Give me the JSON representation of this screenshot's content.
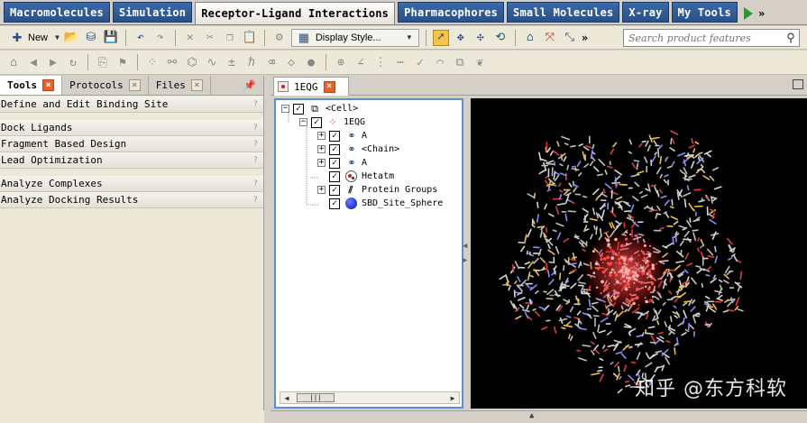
{
  "top_tabs": [
    {
      "label": "Macromolecules",
      "active": false
    },
    {
      "label": "Simulation",
      "active": false
    },
    {
      "label": "Receptor-Ligand Interactions",
      "active": true
    },
    {
      "label": "Pharmacophores",
      "active": false
    },
    {
      "label": "Small Molecules",
      "active": false
    },
    {
      "label": "X-ray",
      "active": false
    },
    {
      "label": "My Tools",
      "active": false
    }
  ],
  "toolbar": {
    "new_label": "New",
    "display_style_label": "Display Style...",
    "search_placeholder": "Search product features"
  },
  "left_panel": {
    "tabs": [
      {
        "label": "Tools",
        "active": true
      },
      {
        "label": "Protocols",
        "active": false
      },
      {
        "label": "Files",
        "active": false
      }
    ],
    "tools": [
      {
        "label": "Define and Edit Binding Site",
        "help": "?"
      },
      {
        "label": "Dock Ligands",
        "help": "?"
      },
      {
        "label": "Fragment Based Design",
        "help": "?"
      },
      {
        "label": "Lead Optimization",
        "help": "?"
      },
      {
        "label": "Analyze Complexes",
        "help": "?"
      },
      {
        "label": "Analyze Docking Results",
        "help": "?"
      }
    ]
  },
  "document": {
    "tab_label": "1EQG"
  },
  "tree": {
    "root": "<Cell>",
    "molecule": "1EQG",
    "items": [
      {
        "label": "A",
        "icon": "chain-icon",
        "expandable": true
      },
      {
        "label": "<Chain>",
        "icon": "chain-icon",
        "expandable": true
      },
      {
        "label": "A",
        "icon": "chain-icon",
        "expandable": true
      },
      {
        "label": "Hetatm",
        "icon": "hetatm-icon",
        "expandable": false
      },
      {
        "label": "Protein Groups",
        "icon": "groups-icon",
        "expandable": true
      },
      {
        "label": "SBD_Site_Sphere",
        "icon": "sphere-icon",
        "expandable": false
      }
    ]
  },
  "viewer": {
    "watermark": "知乎 @东方科软"
  },
  "colors": {
    "tab_blue": "#2a4f86",
    "close_orange": "#e8602a",
    "tree_border": "#5c8ed0",
    "sphere_blue": "#0010c0"
  }
}
